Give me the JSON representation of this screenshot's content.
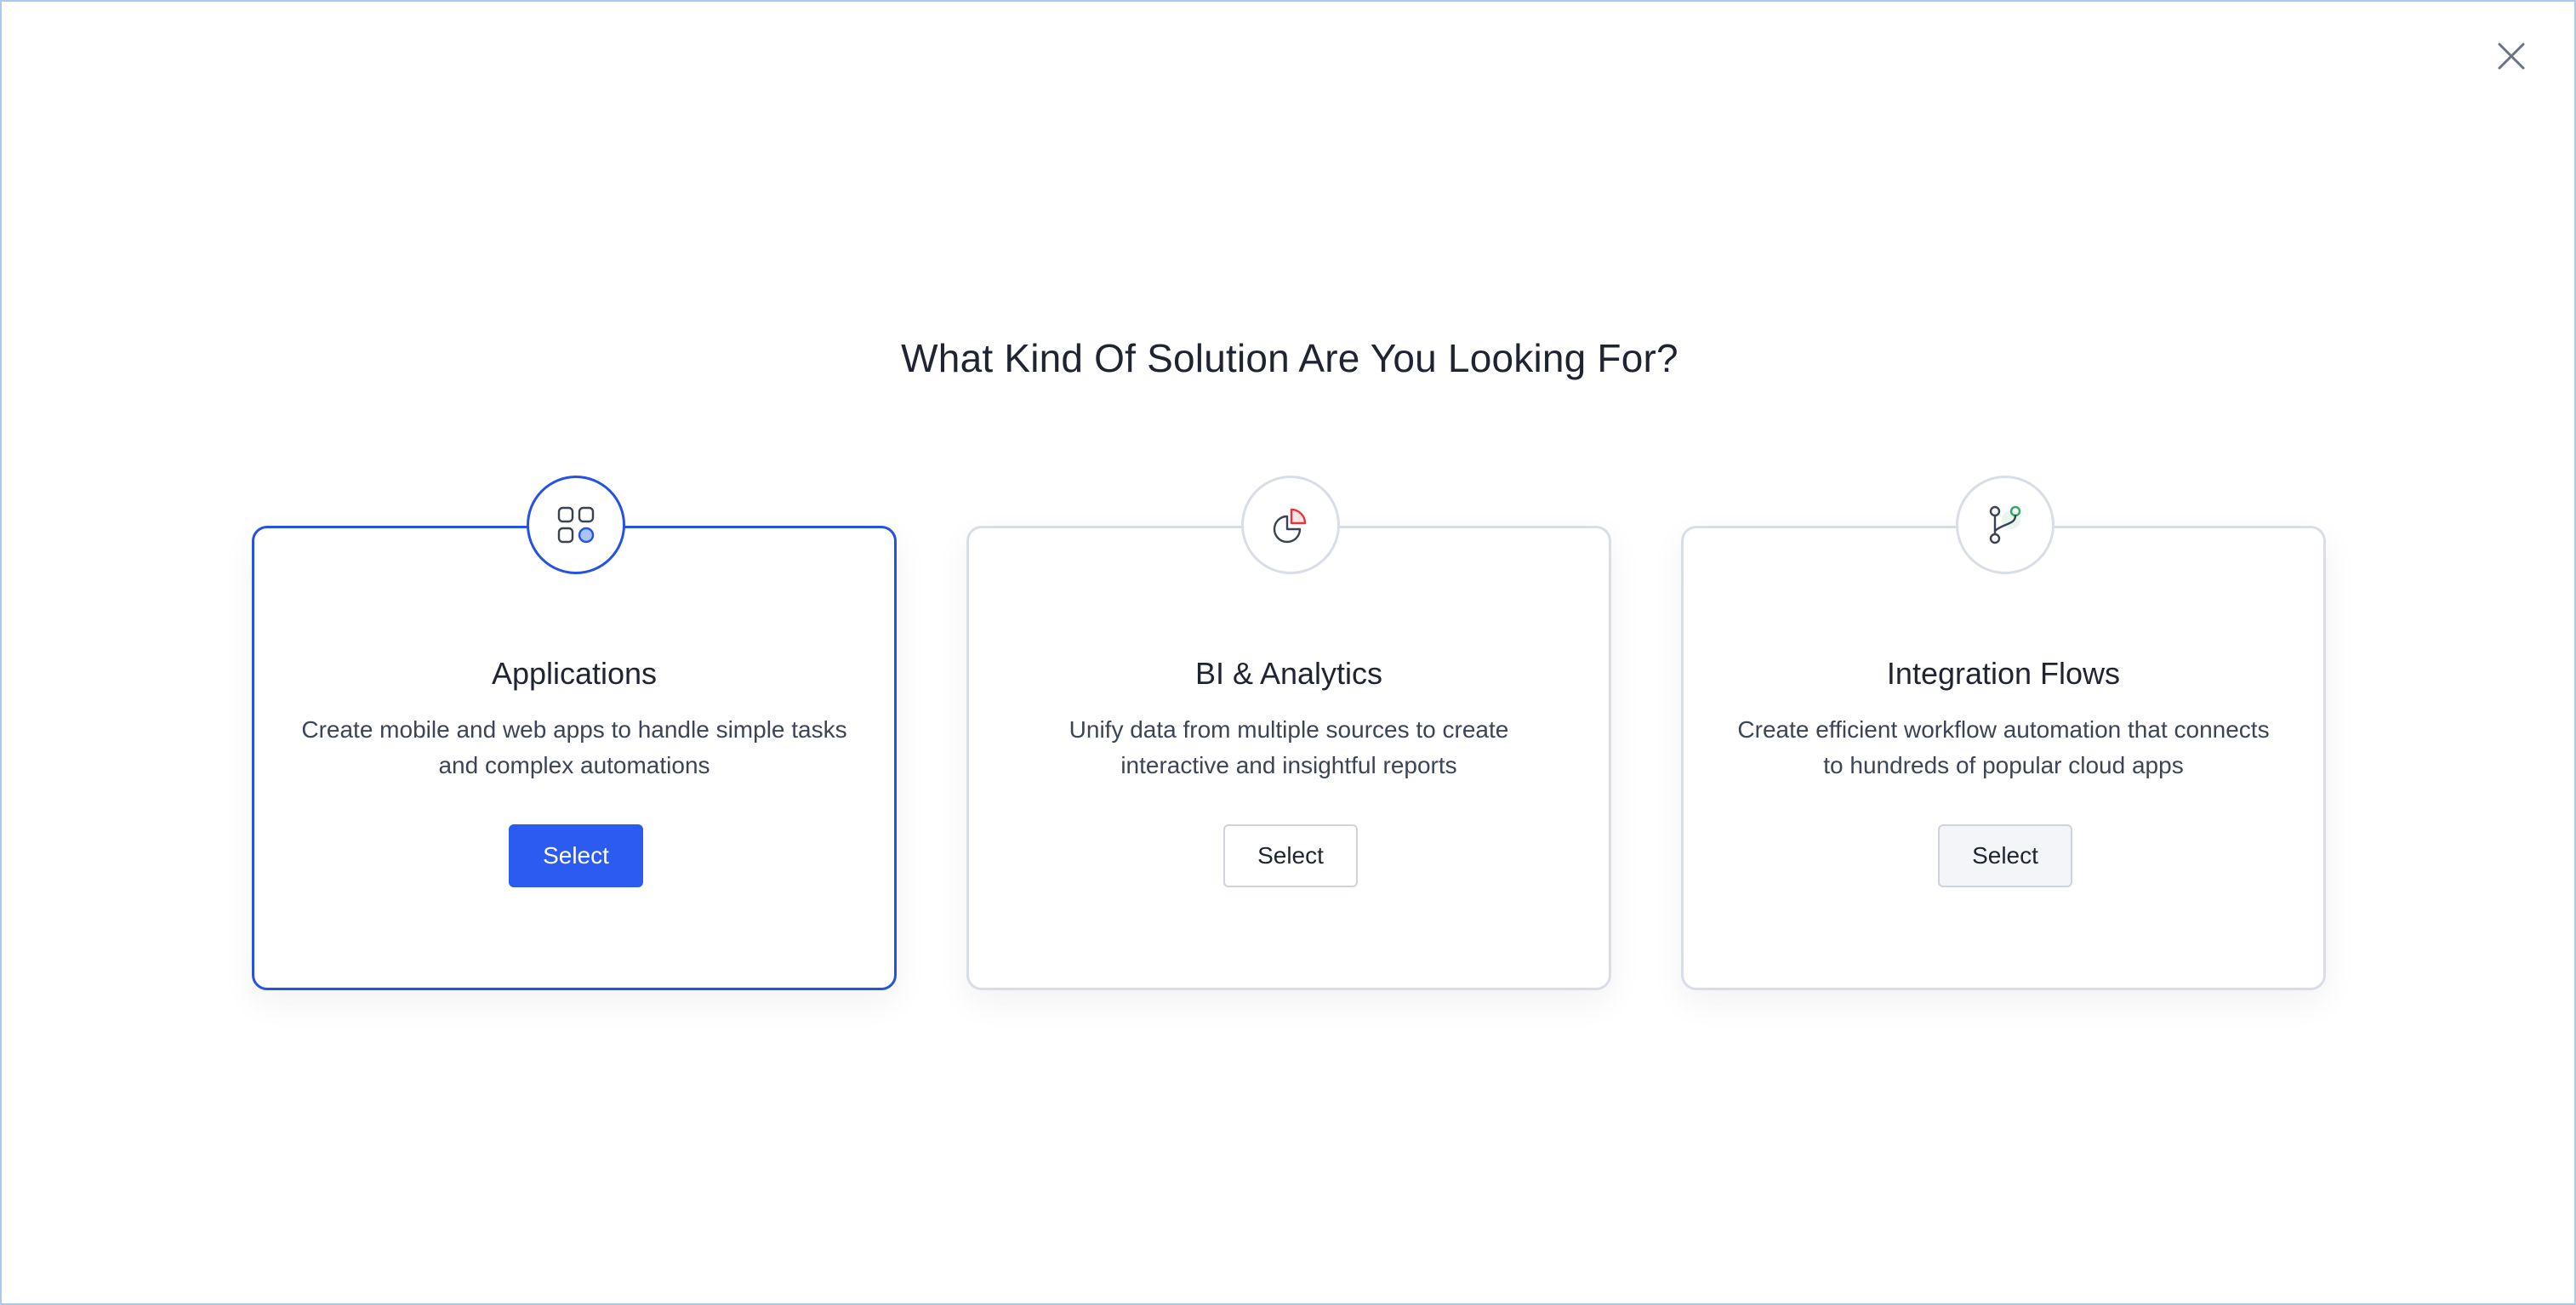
{
  "page": {
    "title": "What Kind Of Solution Are You Looking For?"
  },
  "close": {
    "icon": "close-icon"
  },
  "colors": {
    "accent": "#2552e6",
    "primary_button": "#2b5bf0",
    "border": "#d9dde5",
    "text": "#1f2430",
    "muted_text": "#3d4456",
    "analytics_red": "#e8323c",
    "flow_green": "#2fa866"
  },
  "cards": [
    {
      "title": "Applications",
      "description": "Create mobile and web apps to handle simple tasks and complex automations",
      "button_label": "Select",
      "icon": "apps-grid-icon",
      "selected": true
    },
    {
      "title": "BI & Analytics",
      "description": "Unify data from multiple sources to create interactive and insightful reports",
      "button_label": "Select",
      "icon": "pie-chart-icon",
      "selected": false
    },
    {
      "title": "Integration Flows",
      "description": "Create efficient workflow automation that connects to hundreds of popular cloud apps",
      "button_label": "Select",
      "icon": "flow-branch-icon",
      "selected": false
    }
  ]
}
